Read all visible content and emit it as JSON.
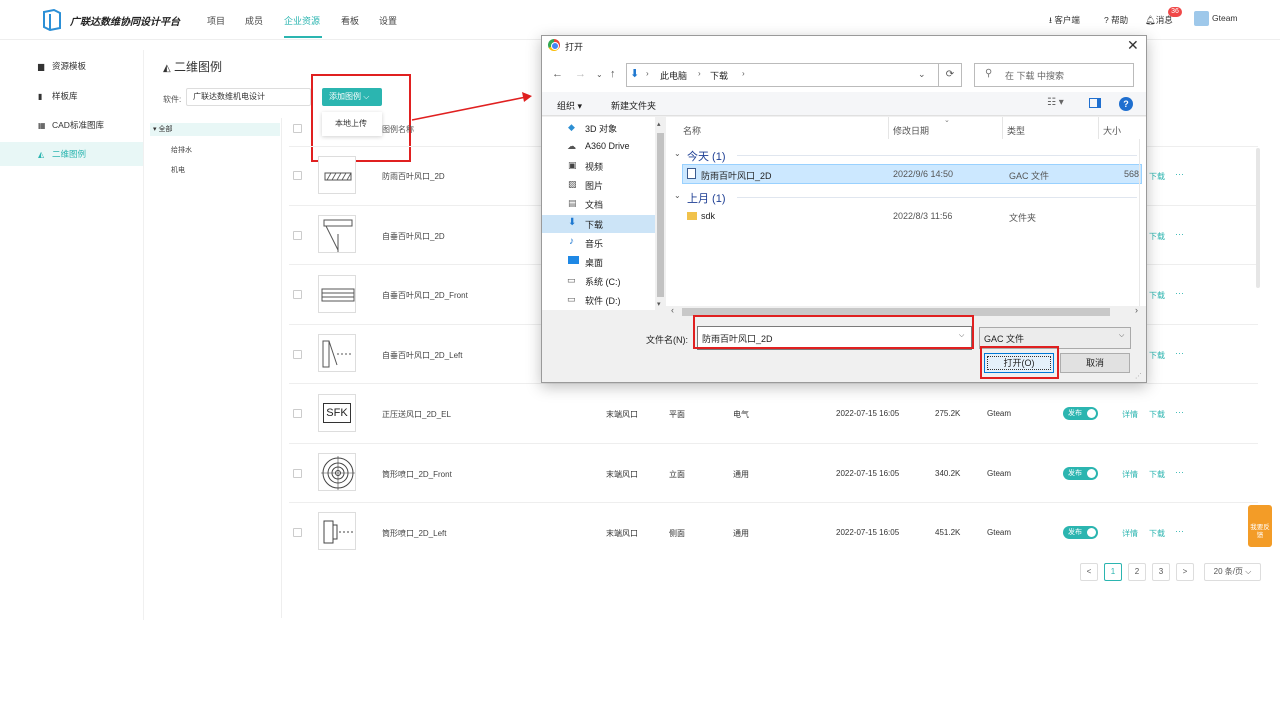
{
  "header": {
    "app_title": "广联达数维协同设计平台",
    "nav": [
      "项目",
      "成员",
      "企业资源",
      "看板",
      "设置"
    ],
    "active_nav": "企业资源",
    "client_label": "客户端",
    "help_label": "帮助",
    "messages_label": "消息",
    "messages_badge": "36",
    "user_name": "Gteam",
    "accent_color": "#2bb5b0"
  },
  "sidebar": {
    "items": [
      {
        "label": "资源模板",
        "icon": "briefcase-icon"
      },
      {
        "label": "样板库",
        "icon": "book-icon"
      },
      {
        "label": "CAD标准图库",
        "icon": "grid-icon"
      },
      {
        "label": "二维图例",
        "icon": "shapes-icon"
      }
    ],
    "active": "二维图例"
  },
  "main": {
    "title": "二维图例",
    "software_label": "软件:",
    "software_value": "广联达数维机电设计",
    "add_button": "添加图例",
    "dropdown_items": [
      "本地上传"
    ],
    "tree": {
      "root": "全部",
      "children": [
        "给排水",
        "机电"
      ]
    },
    "columns": {
      "name": "图例名称"
    },
    "rows": [
      {
        "name": "防雨百叶风口_2D",
        "thumb": "louver"
      },
      {
        "name": "自垂百叶风口_2D",
        "thumb": "vertical-louver"
      },
      {
        "name": "自垂百叶风口_2D_Front",
        "thumb": "front-louver"
      },
      {
        "name": "自垂百叶风口_2D_Left",
        "thumb": "left-louver"
      },
      {
        "name": "正压送风口_2D_EL",
        "thumb": "sfk",
        "thumb_text": "SFK",
        "category": "末端风口",
        "view": "平面",
        "discipline": "电气",
        "date": "2022-07-15 16:05",
        "size": "275.2K",
        "owner": "Gteam"
      },
      {
        "name": "筒形喷口_2D_Front",
        "thumb": "circle-nozzle",
        "category": "末端风口",
        "view": "立面",
        "discipline": "通用",
        "date": "2022-07-15 16:05",
        "size": "340.2K",
        "owner": "Gteam"
      },
      {
        "name": "筒形喷口_2D_Left",
        "thumb": "side-nozzle",
        "category": "末端风口",
        "view": "侧面",
        "discipline": "通用",
        "date": "2022-07-15 16:05",
        "size": "451.2K",
        "owner": "Gteam"
      }
    ],
    "publish_label": "发布",
    "detail_label": "详情",
    "download_label": "下载",
    "more_label": "···",
    "pagination": {
      "pages": [
        "1",
        "2",
        "3"
      ],
      "current": "1",
      "per_page": "20 条/页",
      "prev": "<",
      "next": ">"
    }
  },
  "feedback": "我要反馈",
  "dialog": {
    "title": "打开",
    "breadcrumb": [
      "此电脑",
      "下载"
    ],
    "search_placeholder": "在 下载 中搜索",
    "organize": "组织",
    "new_folder": "新建文件夹",
    "tree_items": [
      "3D 对象",
      "A360 Drive",
      "视频",
      "图片",
      "文档",
      "下载",
      "音乐",
      "桌面",
      "系统 (C:)",
      "软件 (D:)"
    ],
    "tree_selected": "下载",
    "columns": [
      "名称",
      "修改日期",
      "类型",
      "大小"
    ],
    "groups": [
      {
        "label": "今天 (1)",
        "files": [
          {
            "name": "防雨百叶风口_2D",
            "date": "2022/9/6 14:50",
            "type": "GAC 文件",
            "size": "568"
          }
        ]
      },
      {
        "label": "上月 (1)",
        "files": [
          {
            "name": "sdk",
            "date": "2022/8/3 11:56",
            "type": "文件夹",
            "size": ""
          }
        ]
      }
    ],
    "filename_label": "文件名(N):",
    "filename_value": "防雨百叶风口_2D",
    "filetype_value": "GAC 文件",
    "open_button": "打开(O)",
    "cancel_button": "取消"
  }
}
